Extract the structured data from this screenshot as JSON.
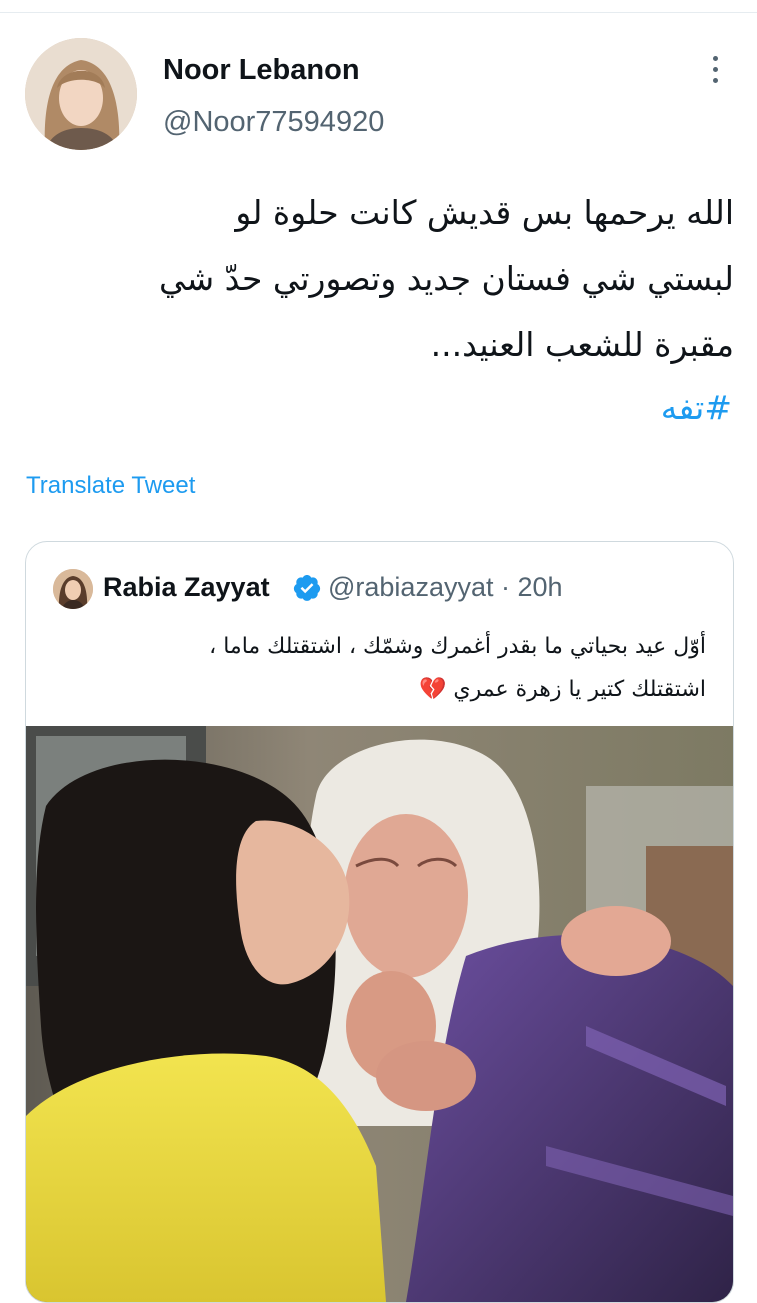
{
  "author": {
    "name": "Noor Lebanon",
    "handle": "@Noor77594920"
  },
  "tweet": {
    "text_lines": [
      "الله يرحمها بس قديش كانت حلوة لو",
      "لبستي شي فستان جديد وتصورتي حدّ شي",
      "مقبرة للشعب العنيد..."
    ],
    "hashtag": "#تفه",
    "translate_label": "Translate Tweet"
  },
  "quoted_tweet": {
    "name": "Rabia Zayyat",
    "handle": "@rabiazayyat",
    "separator": "·",
    "time": "20h",
    "text_lines": [
      "أوّل عيد بحياتي ما بقدر أغمرك وشمّك ، اشتقتلك ماما ،",
      "اشتقتلك كتير يا زهرة عمري 💔"
    ]
  },
  "icons": {
    "more": "more-vertical-icon",
    "verified": "verified-badge-icon"
  },
  "colors": {
    "link": "#1d9bf0",
    "secondary_text": "#536471",
    "border": "#cfd9de"
  }
}
